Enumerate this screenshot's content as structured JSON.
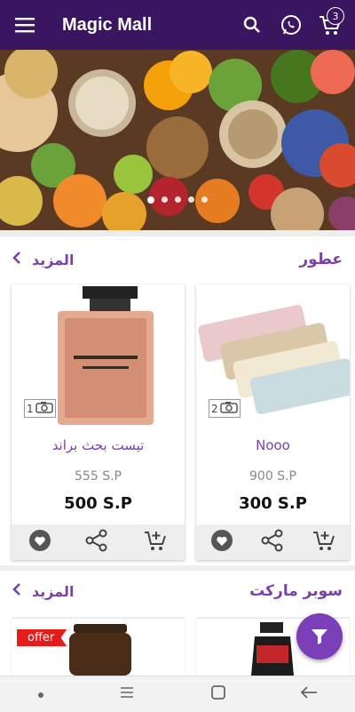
{
  "app": {
    "title": "Magic Mall",
    "cart_count": "3"
  },
  "banner": {
    "slides": 5,
    "active": 0
  },
  "sections": [
    {
      "title": "عطور",
      "more_label": "المزيد",
      "products": [
        {
          "name": "Nooo",
          "old_price": "900  S.P",
          "new_price": "300  S.P",
          "photo_count": "2"
        },
        {
          "name": "تيست بحث براند",
          "old_price": "555  S.P",
          "new_price": "500  S.P",
          "photo_count": "1"
        }
      ]
    },
    {
      "title": "سوبر ماركت",
      "more_label": "المزيد",
      "products": [
        {
          "offer_label": "offer"
        }
      ]
    }
  ],
  "icons": {
    "menu": "menu-icon",
    "search": "search-icon",
    "whatsapp": "whatsapp-icon",
    "cart": "cart-icon",
    "camera": "camera-icon",
    "favorite": "heart-icon",
    "share": "share-icon",
    "add_cart": "add-to-cart-icon",
    "filter": "filter-icon"
  },
  "colors": {
    "appbar": "#3a1660",
    "accent": "#7b3fa8",
    "offer": "#e41c1c",
    "fab": "#7b3fb8"
  }
}
